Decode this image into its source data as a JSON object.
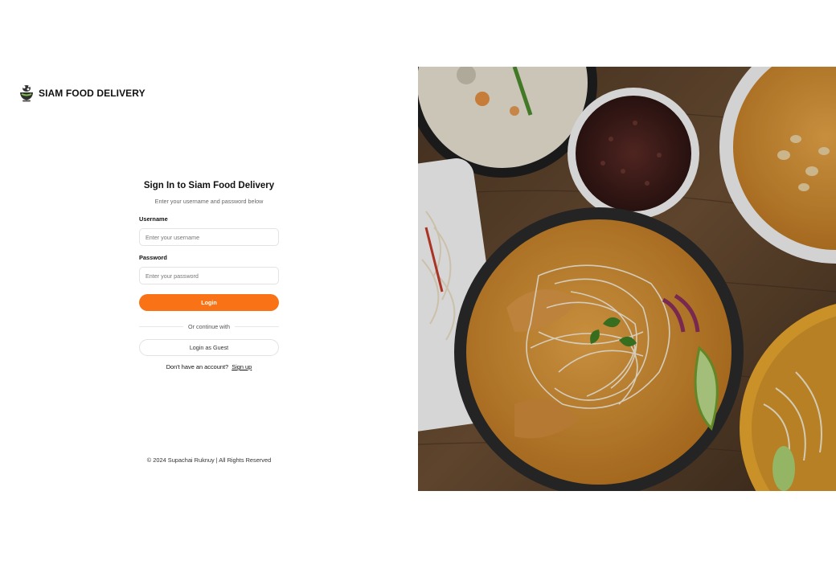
{
  "brand": {
    "name": "SIAM FOOD DELIVERY",
    "logo_icon": "food-bowl-logo-icon"
  },
  "form": {
    "title": "Sign In to Siam Food Delivery",
    "subtitle": "Enter your username and password below",
    "username_label": "Username",
    "username_placeholder": "Enter your username",
    "password_label": "Password",
    "password_placeholder": "Enter your password",
    "login_label": "Login",
    "divider_text": "Or continue with",
    "guest_label": "Login as Guest",
    "signup_prompt": "Don't have an account?",
    "signup_link": "Sign up"
  },
  "footer": {
    "text": "© 2024 Supachai Ruknuy | All Rights Reserved"
  },
  "colors": {
    "accent": "#f97316",
    "background": "#ffffff",
    "text": "#111111"
  },
  "hero": {
    "description_icon": "food-photo"
  }
}
